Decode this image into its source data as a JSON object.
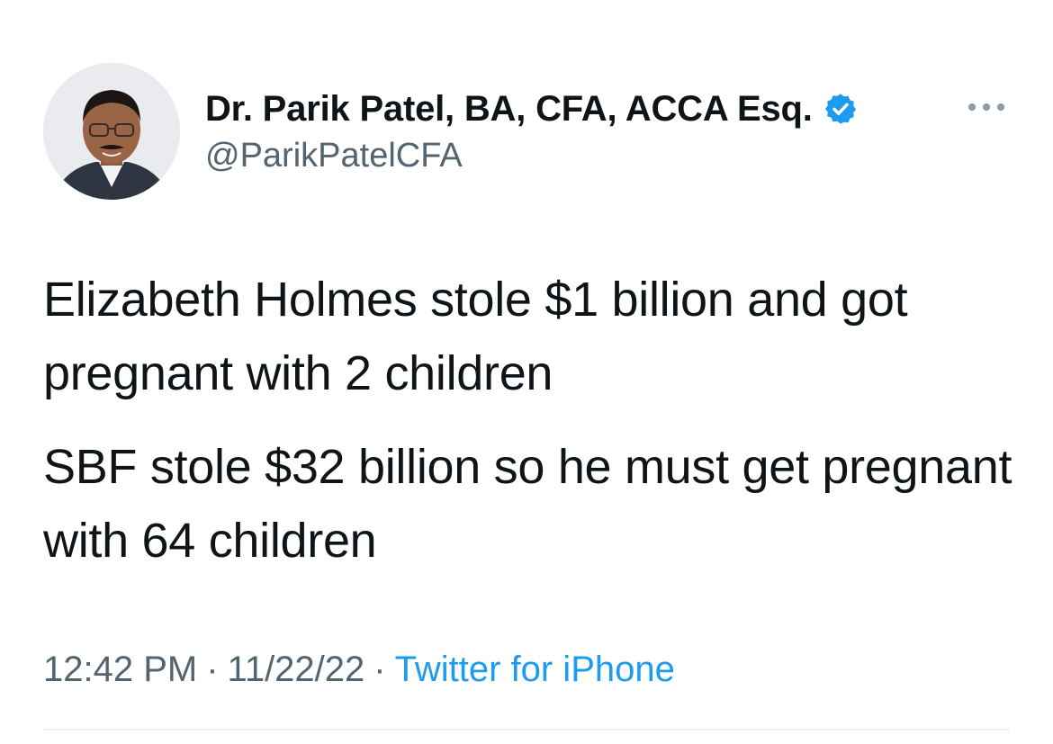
{
  "author": {
    "display_name": "Dr. Parik Patel, BA, CFA, ACCA Esq.",
    "handle": "@ParikPatelCFA",
    "verified": true,
    "avatar_icon": "profile-photo"
  },
  "tweet": {
    "paragraphs": [
      "Elizabeth Holmes stole $1 billion and got pregnant with 2 children",
      "SBF stole $32 billion so he must get pregnant with 64 children"
    ]
  },
  "meta": {
    "time": "12:42 PM",
    "separator": "·",
    "date": "11/22/22",
    "source": "Twitter for iPhone"
  },
  "icons": {
    "verified": "verified-badge-icon",
    "more": "more-options-icon"
  },
  "colors": {
    "text": "#0f1419",
    "secondary": "#536471",
    "accent": "#1d9bf0",
    "divider": "#eff3f4"
  }
}
